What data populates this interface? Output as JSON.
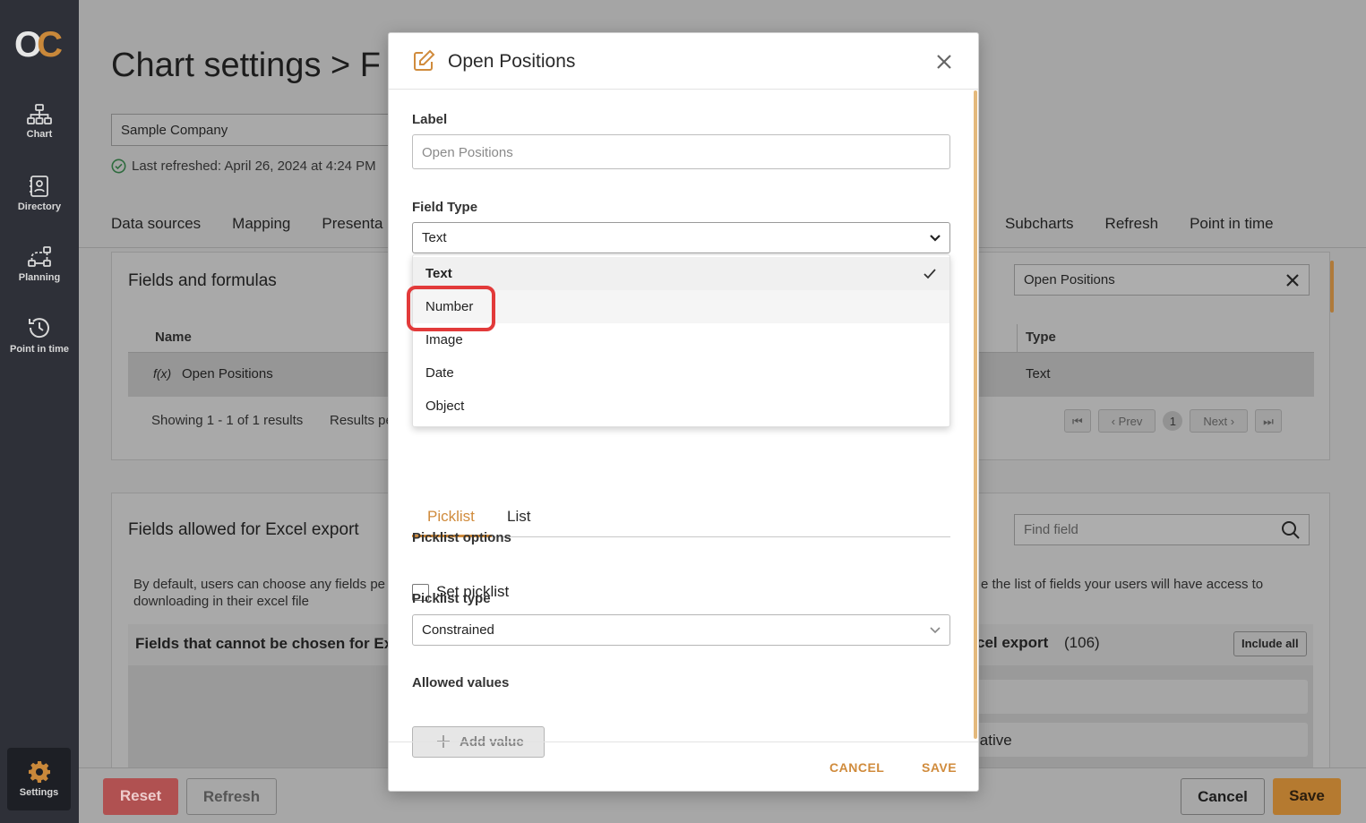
{
  "sidebar": {
    "logo": {
      "o": "O",
      "c": "C"
    },
    "items": [
      {
        "label": "Chart",
        "icon": "org-chart-icon"
      },
      {
        "label": "Directory",
        "icon": "directory-icon"
      },
      {
        "label": "Planning",
        "icon": "planning-icon"
      },
      {
        "label": "Point in time",
        "icon": "history-icon"
      }
    ],
    "settings": {
      "label": "Settings",
      "icon": "gear-icon"
    }
  },
  "page": {
    "title": "Chart settings > F",
    "company": "Sample Company",
    "last_refreshed": "Last refreshed: April 26, 2024 at 4:24 PM",
    "tabs_left": [
      "Data sources",
      "Mapping",
      "Presenta"
    ],
    "tabs_right": [
      "Subcharts",
      "Refresh",
      "Point in time"
    ],
    "fields_card": {
      "title": "Fields and formulas",
      "search_value": "Open Positions",
      "col_name": "Name",
      "col_type": "Type",
      "row": {
        "name": "Open Positions",
        "type": "Text",
        "formula_icon": "f(x)"
      },
      "showing": "Showing 1 - 1 of 1 results",
      "results_per": "Results pe",
      "pager": {
        "prev": "Prev",
        "page": "1",
        "next": "Next"
      }
    },
    "excel_card": {
      "title": "Fields allowed for Excel export",
      "search_placeholder": "Find field",
      "desc_left_1": "By default, users can choose any fields pe",
      "desc_left_2": "downloading in their excel file",
      "desc_right": "e the list of fields your users will have access to",
      "left_header": "Fields that cannot be chosen for Ex",
      "right_header": "cel export",
      "right_count": "(106)",
      "include_all": "Include all",
      "right_item": "lative"
    },
    "bottom": {
      "reset": "Reset",
      "refresh": "Refresh",
      "cancel": "Cancel",
      "save": "Save"
    }
  },
  "modal": {
    "title": "Open Positions",
    "label_heading": "Label",
    "label_placeholder": "Open Positions",
    "field_type_heading": "Field Type",
    "field_type_value": "Text",
    "options": [
      "Text",
      "Number",
      "Image",
      "Date",
      "Object"
    ],
    "selected_option": "Text",
    "tabs": [
      "Picklist",
      "List"
    ],
    "picklist_options_heading": "Picklist options",
    "set_picklist": "Set picklist",
    "picklist_type_heading": "Picklist type",
    "picklist_type_value": "Constrained",
    "allowed_values_heading": "Allowed values",
    "add_value": "Add value",
    "cancel": "CANCEL",
    "save": "SAVE"
  },
  "colors": {
    "accent": "#d08b3c",
    "highlight": "#e23a3a",
    "sidebar": "#2e3038",
    "reset": "#c85a5a",
    "save": "#c9883a"
  }
}
